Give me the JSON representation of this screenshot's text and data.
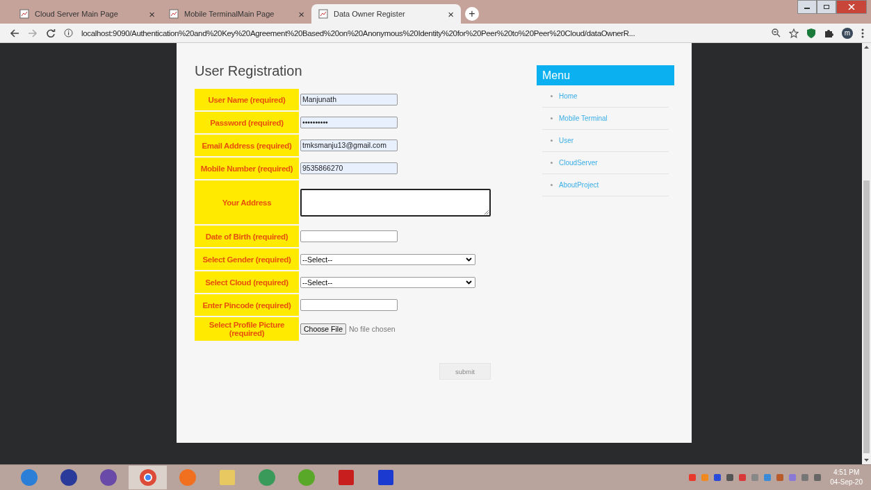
{
  "browser": {
    "tabs": [
      {
        "title": "Cloud Server Main Page",
        "selected": false,
        "close": "×"
      },
      {
        "title": "Mobile TerminalMain Page",
        "selected": false,
        "close": "×"
      },
      {
        "title": "Data Owner Register",
        "selected": true,
        "close": "×"
      }
    ],
    "new_tab": "+",
    "address": "localhost:9090/Authentication%20and%20Key%20Agreement%20Based%20on%20Anonymous%20Identity%20for%20Peer%20to%20Peer%20Cloud/dataOwnerR...",
    "profile": "m"
  },
  "page": {
    "title": "User Registration",
    "fields": [
      {
        "label": "User Name (required)",
        "kind": "text",
        "value": "Manjunath"
      },
      {
        "label": "Password (required)",
        "kind": "text",
        "value": "••••••••••"
      },
      {
        "label": "Email Address (required)",
        "kind": "text",
        "value": "tmksmanju13@gmail.com"
      },
      {
        "label": "Mobile Number (required)",
        "kind": "text",
        "value": "9535866270"
      },
      {
        "label": "Your Address",
        "kind": "textarea"
      },
      {
        "label": "Date of Birth (required)",
        "kind": "text"
      },
      {
        "label": "Select Gender (required)",
        "kind": "select",
        "value": "--Select--"
      },
      {
        "label": "Select Cloud (required)",
        "kind": "select",
        "value": "--Select--"
      },
      {
        "label": "Enter Pincode (required)",
        "kind": "text"
      },
      {
        "label": "Select Profile Picture (required)",
        "kind": "file",
        "button": "Choose File",
        "value": "No file chosen"
      }
    ],
    "submit": "submit",
    "menu": {
      "title": "Menu",
      "items": [
        "Home",
        "Mobile Terminal",
        "User",
        "CloudServer",
        "AboutProject"
      ]
    }
  },
  "taskbar": {
    "time": "4:51 PM",
    "date": "04-Sep-20"
  }
}
